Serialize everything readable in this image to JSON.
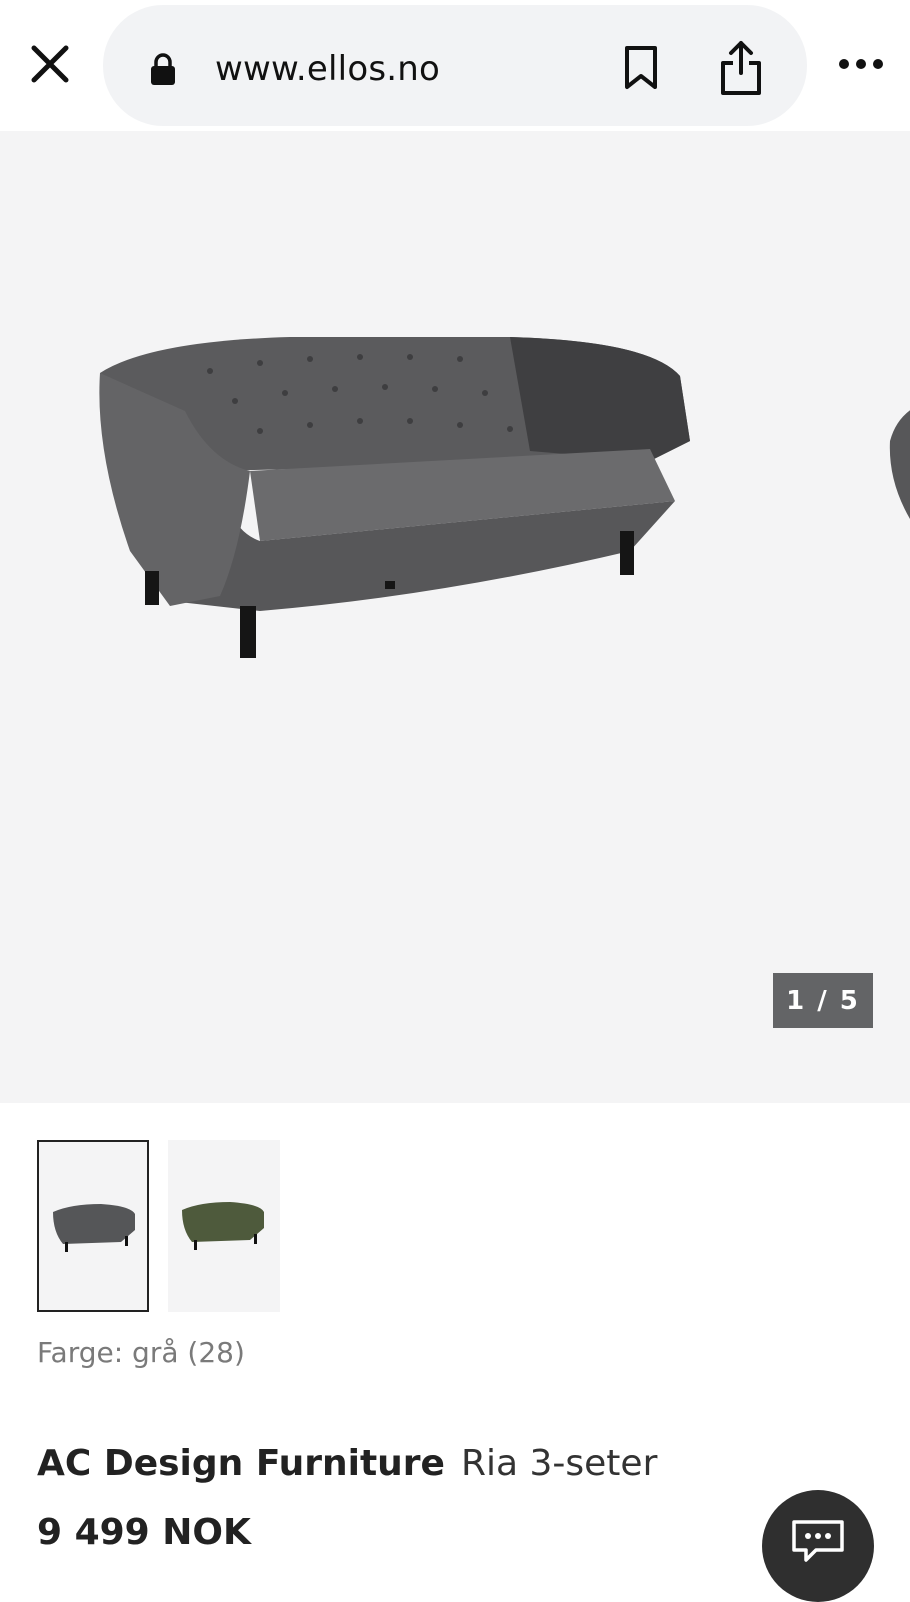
{
  "browser": {
    "url": "www.ellos.no",
    "icons": [
      "close-icon",
      "lock-icon",
      "bookmark-icon",
      "share-icon",
      "more-icon"
    ]
  },
  "gallery": {
    "counter": "1 / 5",
    "current": 1,
    "total": 5
  },
  "thumbnails": [
    {
      "name": "grå",
      "selected": true,
      "color": "#555658"
    },
    {
      "name": "grønn",
      "selected": false,
      "color": "#4e5a3c"
    }
  ],
  "product": {
    "color_label": "Farge: grå (28)",
    "brand": "AC Design Furniture",
    "model": "Ria 3-seter",
    "price": "9 499 NOK"
  },
  "chat": {
    "icon": "chat-icon"
  }
}
